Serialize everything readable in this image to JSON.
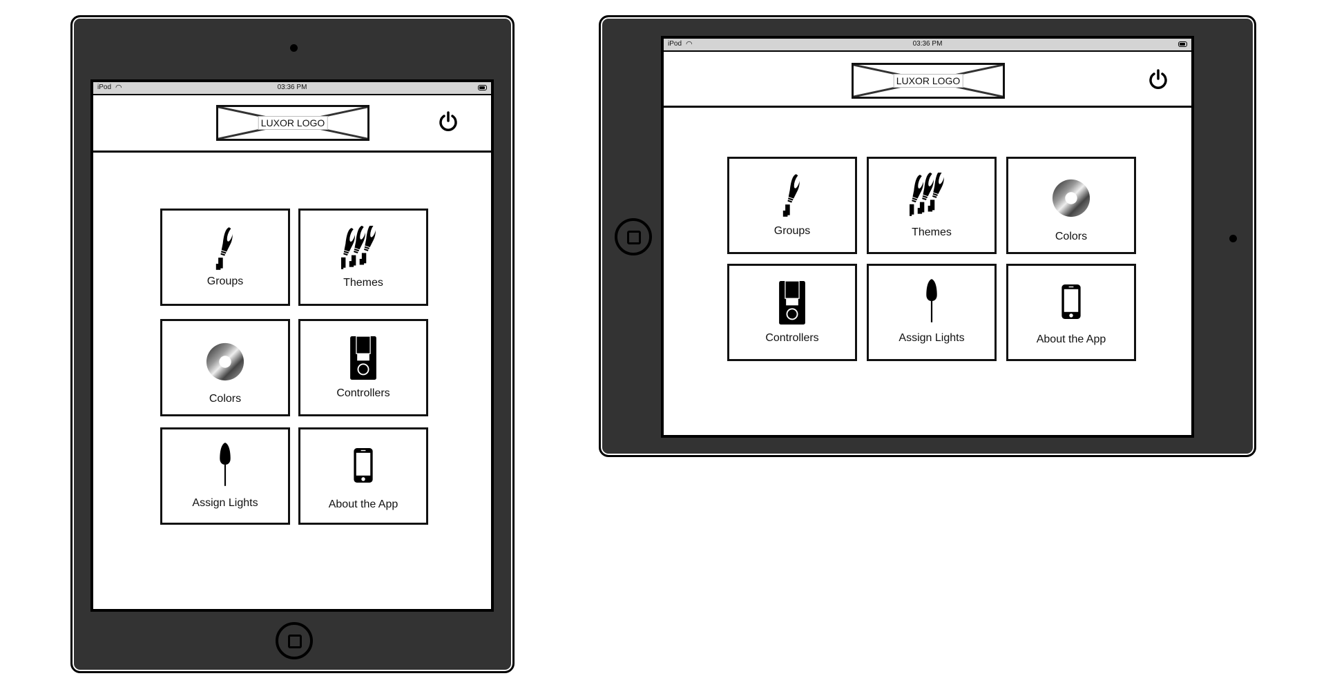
{
  "status_bar": {
    "carrier": "iPod",
    "time": "03:36 PM"
  },
  "header": {
    "logo_label": "LUXOR LOGO",
    "power_icon": "power-icon"
  },
  "menu": [
    {
      "id": "groups",
      "label": "Groups",
      "icon": "spotlight-icon"
    },
    {
      "id": "themes",
      "label": "Themes",
      "icon": "spotlight-group-icon"
    },
    {
      "id": "colors",
      "label": "Colors",
      "icon": "color-wheel-icon"
    },
    {
      "id": "controllers",
      "label": "Controllers",
      "icon": "controller-icon"
    },
    {
      "id": "assign-lights",
      "label": "Assign Lights",
      "icon": "stake-light-icon"
    },
    {
      "id": "about",
      "label": "About the App",
      "icon": "phone-icon"
    }
  ],
  "devices": [
    {
      "orientation": "portrait"
    },
    {
      "orientation": "landscape"
    }
  ]
}
